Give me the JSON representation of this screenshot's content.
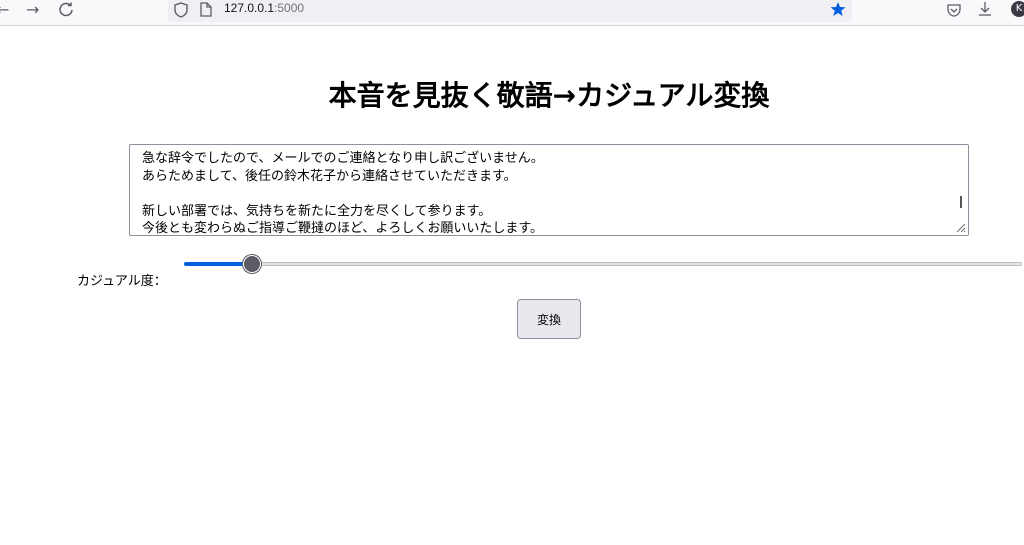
{
  "browser": {
    "url_host": "127.0.0.1",
    "url_port": ":5000",
    "avatar_initial": "K",
    "accent_color": "#0060df"
  },
  "page": {
    "title": "本音を見抜く敬語→カジュアル変換",
    "input_lines": [
      "急な辞令でしたので、メールでのご連絡となり申し訳ございません。",
      "あらためまして、後任の鈴木花子から連絡させていただきます。",
      "",
      "新しい部署では、気持ちを新たに全力を尽くして参ります。",
      "今後とも変わらぬご指導ご鞭撻のほど、よろしくお願いいたします。"
    ],
    "slider_label": "カジュアル度：",
    "slider_value_fraction": 0.08,
    "convert_button": "変換"
  }
}
